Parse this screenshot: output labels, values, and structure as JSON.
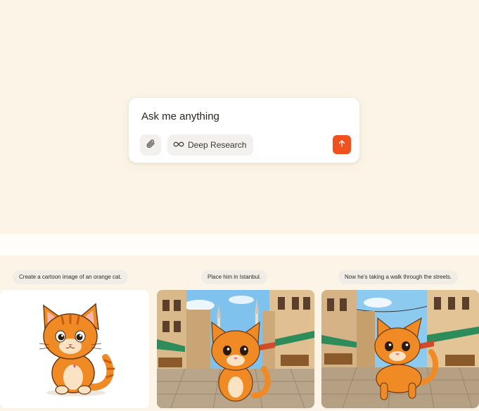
{
  "composer": {
    "placeholder": "Ask me anything",
    "deep_research_label": "Deep Research",
    "icons": {
      "attach": "paperclip-icon",
      "deep_research": "infinity-icon",
      "send": "arrow-up-icon"
    },
    "send_color": "#f0511e"
  },
  "showcase": {
    "steps": [
      {
        "prompt": "Create a cartoon image of an orange cat."
      },
      {
        "prompt": "Place him in Istanbul."
      },
      {
        "prompt": "Now he's taking a walk through the streets."
      }
    ]
  },
  "colors": {
    "background": "#fcf4e6",
    "band": "#fffdfa",
    "pill": "#f0ece6",
    "cat_orange": "#f08a24"
  }
}
